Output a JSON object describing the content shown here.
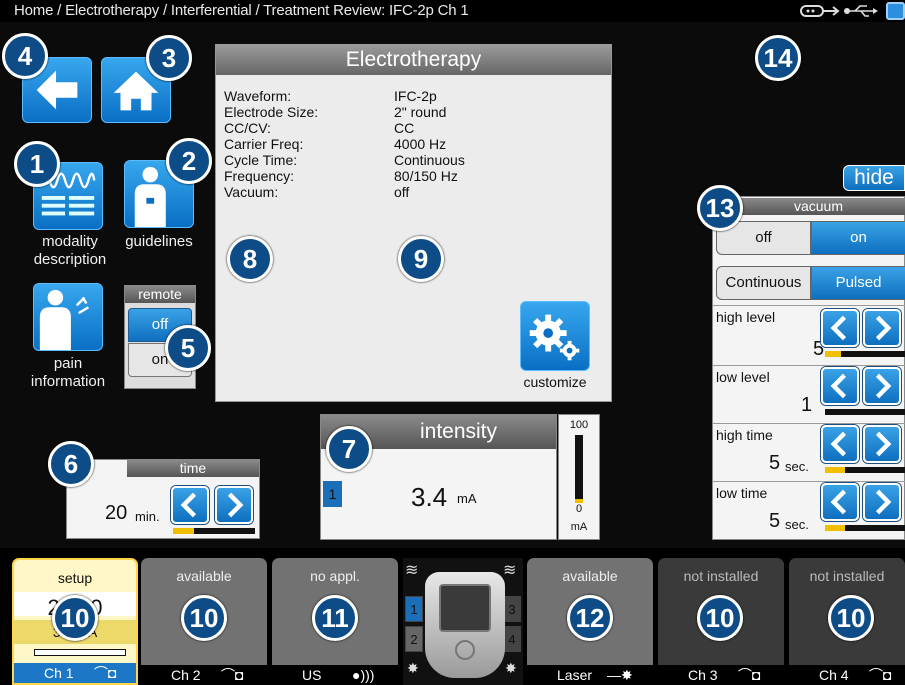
{
  "topbar": {
    "breadcrumb": "Home / Electrotherapy / Interferential / Treatment Review: IFC-2p Ch 1",
    "icons": [
      "connection-icon",
      "usb-icon",
      "battery-icon"
    ]
  },
  "nav": {
    "back_icon": "arrow-left-icon",
    "home_icon": "home-icon"
  },
  "tiles": {
    "modality_description": "modality\ndescription",
    "guidelines": "guidelines",
    "pain_information": "pain\ninformation"
  },
  "remote": {
    "title": "remote",
    "off": "off",
    "on": "on"
  },
  "electro": {
    "title": "Electrotherapy",
    "params": [
      {
        "key": "Waveform:",
        "value": "IFC-2p"
      },
      {
        "key": "Electrode Size:",
        "value": "2\" round"
      },
      {
        "key": "CC/CV:",
        "value": "CC"
      },
      {
        "key": "Carrier Freq:",
        "value": "4000 Hz"
      },
      {
        "key": "Cycle Time:",
        "value": "Continuous"
      },
      {
        "key": "Frequency:",
        "value": "80/150 Hz"
      },
      {
        "key": "Vacuum:",
        "value": "off"
      }
    ],
    "customize": "customize"
  },
  "time": {
    "title": "time",
    "value": "20",
    "unit": "min.",
    "level": 0.25
  },
  "intensity": {
    "title": "intensity",
    "channel": "1",
    "value": "3.4",
    "unit": "mA",
    "scale_max": "100",
    "scale_min": "0",
    "scale_unit": "mA",
    "level": 0.034
  },
  "right": {
    "hide": "hide",
    "vacuum_title": "vacuum",
    "vacuum_off": "off",
    "vacuum_on": "on",
    "mode_continuous": "Continuous",
    "mode_pulsed": "Pulsed",
    "high_level": {
      "label": "high level",
      "value": "5",
      "level": 0.2
    },
    "low_level": {
      "label": "low level",
      "value": "1",
      "level": 0.0
    },
    "high_time": {
      "label": "high time",
      "value": "5",
      "unit": "sec.",
      "level": 0.25
    },
    "low_time": {
      "label": "low time",
      "value": "5",
      "unit": "sec.",
      "level": 0.25
    }
  },
  "channels": [
    {
      "status": "setup",
      "timer": "20:00",
      "current": "3.4 mA",
      "name": "Ch 1"
    },
    {
      "status": "available",
      "name": "Ch 2"
    },
    {
      "status": "no appl.",
      "name": "US"
    },
    {
      "status": "available",
      "name": "Laser"
    },
    {
      "status": "not installed",
      "name": "Ch 3"
    },
    {
      "status": "not installed",
      "name": "Ch 4"
    }
  ],
  "device": {
    "slot1": "1",
    "slot2": "2",
    "slot3": "3",
    "slot4": "4"
  },
  "callouts": [
    "1",
    "2",
    "3",
    "4",
    "5",
    "6",
    "7",
    "8",
    "9",
    "10",
    "10",
    "11",
    "12",
    "10",
    "10",
    "13",
    "14"
  ]
}
